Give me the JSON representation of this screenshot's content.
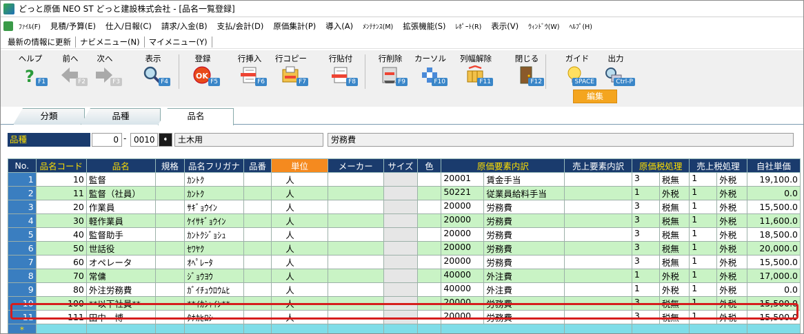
{
  "window": {
    "title": "どっと原価 NEO ST どっと建設株式会社 - [品名一覧登録]"
  },
  "menu": [
    {
      "label": "ﾌｧｲﾙ(F)",
      "small": true
    },
    {
      "label": "見積/予算(E)"
    },
    {
      "label": "仕入/日報(C)"
    },
    {
      "label": "請求/入金(B)"
    },
    {
      "label": "支払/会計(D)"
    },
    {
      "label": "原価集計(P)"
    },
    {
      "label": "導入(A)"
    },
    {
      "label": "ﾒﾝﾃﾅﾝｽ(M)",
      "small": true
    },
    {
      "label": "拡張機能(S)"
    },
    {
      "label": "ﾚﾎﾟｰﾄ(R)",
      "small": true
    },
    {
      "label": "表示(V)"
    },
    {
      "label": "ｳｨﾝﾄﾞｳ(W)",
      "small": true
    },
    {
      "label": "ﾍﾙﾌﾟ(H)",
      "small": true
    }
  ],
  "links": [
    "最新の情報に更新",
    "ナビメニュー(N)",
    "マイメニュー(Y)"
  ],
  "toolbar": [
    {
      "label": "ヘルプ",
      "key": "F1",
      "icon": "help-icon",
      "enabled": true
    },
    {
      "label": "前へ",
      "key": "F2",
      "icon": "arrow-left-icon",
      "enabled": false
    },
    {
      "label": "次へ",
      "key": "F3",
      "icon": "arrow-right-icon",
      "enabled": false
    },
    {
      "label": "表示",
      "key": "F4",
      "icon": "magnifier-icon",
      "enabled": true
    },
    {
      "label": "登録",
      "key": "F5",
      "icon": "ok-icon",
      "enabled": true
    },
    {
      "label": "行挿入",
      "key": "F6",
      "icon": "insert-row-icon",
      "enabled": true
    },
    {
      "label": "行コピー",
      "key": "F7",
      "icon": "copy-row-icon",
      "enabled": true
    },
    {
      "label": "行貼付",
      "key": "F8",
      "icon": "paste-row-icon",
      "enabled": true
    },
    {
      "label": "行削除",
      "key": "F9",
      "icon": "delete-row-icon",
      "enabled": true
    },
    {
      "label": "カーソル",
      "key": "F10",
      "icon": "cursor-icon",
      "enabled": true
    },
    {
      "label": "列幅解除",
      "key": "F11",
      "icon": "column-width-icon",
      "enabled": true
    },
    {
      "label": "閉じる",
      "key": "F12",
      "icon": "door-close-icon",
      "enabled": true
    },
    {
      "label": "ガイド",
      "key": "SPACE",
      "icon": "lightbulb-icon",
      "enabled": true
    },
    {
      "label": "出力",
      "key": "Ctrl-P",
      "icon": "printer-icon",
      "enabled": true
    }
  ],
  "edit_button": "編集",
  "tabs": [
    "分類",
    "品種",
    "品名"
  ],
  "filter": {
    "label": "品種",
    "from": "0",
    "dash": "-",
    "to": "0010",
    "name": "土木用",
    "category": "労務費"
  },
  "columns": [
    "No.",
    "品名コード",
    "品名",
    "規格",
    "品名フリガナ",
    "品番",
    "単位",
    "メーカー",
    "サイズ",
    "色",
    "原価要素内訳",
    "売上要素内訳",
    "原価税処理",
    "売上税処理",
    "自社単価"
  ],
  "rows": [
    {
      "no": "1",
      "code": "10",
      "name": "監督",
      "kana": "ｶﾝﾄｸ",
      "unit": "人",
      "ecode": "20001",
      "ename": "賃金手当",
      "ctax": "3",
      "ctaxname": "税無",
      "stax": "1",
      "staxname": "外税",
      "price": "19,100.0"
    },
    {
      "no": "2",
      "code": "11",
      "name": "監督（社員）",
      "kana": "ｶﾝﾄｸ",
      "unit": "人",
      "ecode": "50221",
      "ename": "従業員給料手当",
      "ctax": "1",
      "ctaxname": "外税",
      "stax": "1",
      "staxname": "外税",
      "price": "0.0"
    },
    {
      "no": "3",
      "code": "20",
      "name": "作業員",
      "kana": "ｻｷﾞｮｳｲﾝ",
      "unit": "人",
      "ecode": "20000",
      "ename": "労務費",
      "ctax": "3",
      "ctaxname": "税無",
      "stax": "1",
      "staxname": "外税",
      "price": "15,500.0"
    },
    {
      "no": "4",
      "code": "30",
      "name": "軽作業員",
      "kana": "ｹｲｻｷﾞｮｳｲﾝ",
      "unit": "人",
      "ecode": "20000",
      "ename": "労務費",
      "ctax": "3",
      "ctaxname": "税無",
      "stax": "1",
      "staxname": "外税",
      "price": "11,600.0"
    },
    {
      "no": "5",
      "code": "40",
      "name": "監督助手",
      "kana": "ｶﾝﾄｸｼﾞｮｼｭ",
      "unit": "人",
      "ecode": "20000",
      "ename": "労務費",
      "ctax": "3",
      "ctaxname": "税無",
      "stax": "1",
      "staxname": "外税",
      "price": "18,500.0"
    },
    {
      "no": "6",
      "code": "50",
      "name": "世話役",
      "kana": "ｾﾜﾔｸ",
      "unit": "人",
      "ecode": "20000",
      "ename": "労務費",
      "ctax": "3",
      "ctaxname": "税無",
      "stax": "1",
      "staxname": "外税",
      "price": "20,000.0"
    },
    {
      "no": "7",
      "code": "60",
      "name": "オペレータ",
      "kana": "ｵﾍﾟﾚｰﾀ",
      "unit": "人",
      "ecode": "20000",
      "ename": "労務費",
      "ctax": "3",
      "ctaxname": "税無",
      "stax": "1",
      "staxname": "外税",
      "price": "15,500.0"
    },
    {
      "no": "8",
      "code": "70",
      "name": "常傭",
      "kana": "ｼﾞｮｳﾖｳ",
      "unit": "人",
      "ecode": "40000",
      "ename": "外注費",
      "ctax": "1",
      "ctaxname": "外税",
      "stax": "1",
      "staxname": "外税",
      "price": "17,000.0"
    },
    {
      "no": "9",
      "code": "80",
      "name": "外注労務費",
      "kana": "ｶﾞｲﾁｭｳﾛｳﾑﾋ",
      "unit": "人",
      "ecode": "40000",
      "ename": "外注費",
      "ctax": "1",
      "ctaxname": "外税",
      "stax": "1",
      "staxname": "外税",
      "price": "0.0"
    },
    {
      "no": "10",
      "code": "100",
      "name": "**以下社員**",
      "kana": "**ｲｶｼｬｲﾝ**",
      "unit": "人",
      "ecode": "20000",
      "ename": "労務費",
      "ctax": "3",
      "ctaxname": "税無",
      "stax": "1",
      "staxname": "外税",
      "price": "15,500.0"
    },
    {
      "no": "11",
      "code": "111",
      "name": "田中　博",
      "kana": "ﾀﾅｶﾋﾛｼ",
      "unit": "人",
      "ecode": "20000",
      "ename": "労務費",
      "ctax": "3",
      "ctaxname": "税無",
      "stax": "1",
      "staxname": "外税",
      "price": "15,500.0"
    }
  ],
  "new_row_marker": "*",
  "colors": {
    "header_navy": "#1a3b6d",
    "header_yellow": "#ffdf00",
    "unit_orange": "#f58a1f",
    "row_green": "#c9f3c5",
    "highlight_red": "#d61d1d",
    "function_key_blue": "#3a86c8"
  }
}
